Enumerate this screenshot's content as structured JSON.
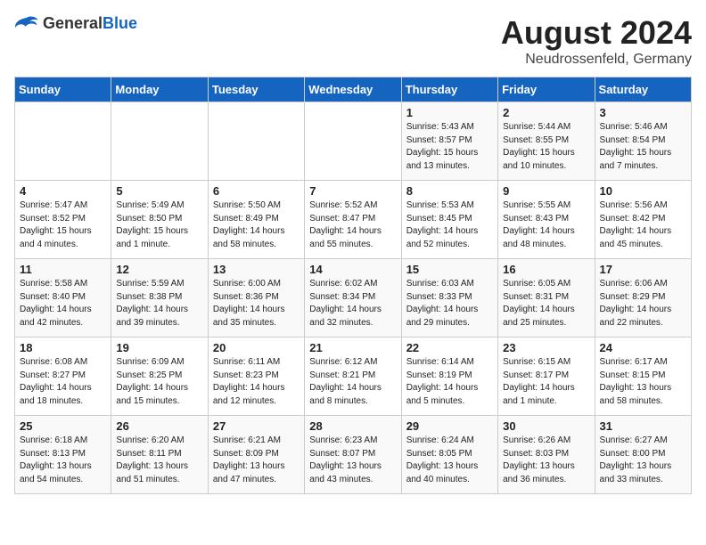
{
  "header": {
    "logo_general": "General",
    "logo_blue": "Blue",
    "month_year": "August 2024",
    "location": "Neudrossenfeld, Germany"
  },
  "weekdays": [
    "Sunday",
    "Monday",
    "Tuesday",
    "Wednesday",
    "Thursday",
    "Friday",
    "Saturday"
  ],
  "weeks": [
    [
      {
        "day": "",
        "info": ""
      },
      {
        "day": "",
        "info": ""
      },
      {
        "day": "",
        "info": ""
      },
      {
        "day": "",
        "info": ""
      },
      {
        "day": "1",
        "info": "Sunrise: 5:43 AM\nSunset: 8:57 PM\nDaylight: 15 hours\nand 13 minutes."
      },
      {
        "day": "2",
        "info": "Sunrise: 5:44 AM\nSunset: 8:55 PM\nDaylight: 15 hours\nand 10 minutes."
      },
      {
        "day": "3",
        "info": "Sunrise: 5:46 AM\nSunset: 8:54 PM\nDaylight: 15 hours\nand 7 minutes."
      }
    ],
    [
      {
        "day": "4",
        "info": "Sunrise: 5:47 AM\nSunset: 8:52 PM\nDaylight: 15 hours\nand 4 minutes."
      },
      {
        "day": "5",
        "info": "Sunrise: 5:49 AM\nSunset: 8:50 PM\nDaylight: 15 hours\nand 1 minute."
      },
      {
        "day": "6",
        "info": "Sunrise: 5:50 AM\nSunset: 8:49 PM\nDaylight: 14 hours\nand 58 minutes."
      },
      {
        "day": "7",
        "info": "Sunrise: 5:52 AM\nSunset: 8:47 PM\nDaylight: 14 hours\nand 55 minutes."
      },
      {
        "day": "8",
        "info": "Sunrise: 5:53 AM\nSunset: 8:45 PM\nDaylight: 14 hours\nand 52 minutes."
      },
      {
        "day": "9",
        "info": "Sunrise: 5:55 AM\nSunset: 8:43 PM\nDaylight: 14 hours\nand 48 minutes."
      },
      {
        "day": "10",
        "info": "Sunrise: 5:56 AM\nSunset: 8:42 PM\nDaylight: 14 hours\nand 45 minutes."
      }
    ],
    [
      {
        "day": "11",
        "info": "Sunrise: 5:58 AM\nSunset: 8:40 PM\nDaylight: 14 hours\nand 42 minutes."
      },
      {
        "day": "12",
        "info": "Sunrise: 5:59 AM\nSunset: 8:38 PM\nDaylight: 14 hours\nand 39 minutes."
      },
      {
        "day": "13",
        "info": "Sunrise: 6:00 AM\nSunset: 8:36 PM\nDaylight: 14 hours\nand 35 minutes."
      },
      {
        "day": "14",
        "info": "Sunrise: 6:02 AM\nSunset: 8:34 PM\nDaylight: 14 hours\nand 32 minutes."
      },
      {
        "day": "15",
        "info": "Sunrise: 6:03 AM\nSunset: 8:33 PM\nDaylight: 14 hours\nand 29 minutes."
      },
      {
        "day": "16",
        "info": "Sunrise: 6:05 AM\nSunset: 8:31 PM\nDaylight: 14 hours\nand 25 minutes."
      },
      {
        "day": "17",
        "info": "Sunrise: 6:06 AM\nSunset: 8:29 PM\nDaylight: 14 hours\nand 22 minutes."
      }
    ],
    [
      {
        "day": "18",
        "info": "Sunrise: 6:08 AM\nSunset: 8:27 PM\nDaylight: 14 hours\nand 18 minutes."
      },
      {
        "day": "19",
        "info": "Sunrise: 6:09 AM\nSunset: 8:25 PM\nDaylight: 14 hours\nand 15 minutes."
      },
      {
        "day": "20",
        "info": "Sunrise: 6:11 AM\nSunset: 8:23 PM\nDaylight: 14 hours\nand 12 minutes."
      },
      {
        "day": "21",
        "info": "Sunrise: 6:12 AM\nSunset: 8:21 PM\nDaylight: 14 hours\nand 8 minutes."
      },
      {
        "day": "22",
        "info": "Sunrise: 6:14 AM\nSunset: 8:19 PM\nDaylight: 14 hours\nand 5 minutes."
      },
      {
        "day": "23",
        "info": "Sunrise: 6:15 AM\nSunset: 8:17 PM\nDaylight: 14 hours\nand 1 minute."
      },
      {
        "day": "24",
        "info": "Sunrise: 6:17 AM\nSunset: 8:15 PM\nDaylight: 13 hours\nand 58 minutes."
      }
    ],
    [
      {
        "day": "25",
        "info": "Sunrise: 6:18 AM\nSunset: 8:13 PM\nDaylight: 13 hours\nand 54 minutes."
      },
      {
        "day": "26",
        "info": "Sunrise: 6:20 AM\nSunset: 8:11 PM\nDaylight: 13 hours\nand 51 minutes."
      },
      {
        "day": "27",
        "info": "Sunrise: 6:21 AM\nSunset: 8:09 PM\nDaylight: 13 hours\nand 47 minutes."
      },
      {
        "day": "28",
        "info": "Sunrise: 6:23 AM\nSunset: 8:07 PM\nDaylight: 13 hours\nand 43 minutes."
      },
      {
        "day": "29",
        "info": "Sunrise: 6:24 AM\nSunset: 8:05 PM\nDaylight: 13 hours\nand 40 minutes."
      },
      {
        "day": "30",
        "info": "Sunrise: 6:26 AM\nSunset: 8:03 PM\nDaylight: 13 hours\nand 36 minutes."
      },
      {
        "day": "31",
        "info": "Sunrise: 6:27 AM\nSunset: 8:00 PM\nDaylight: 13 hours\nand 33 minutes."
      }
    ]
  ]
}
